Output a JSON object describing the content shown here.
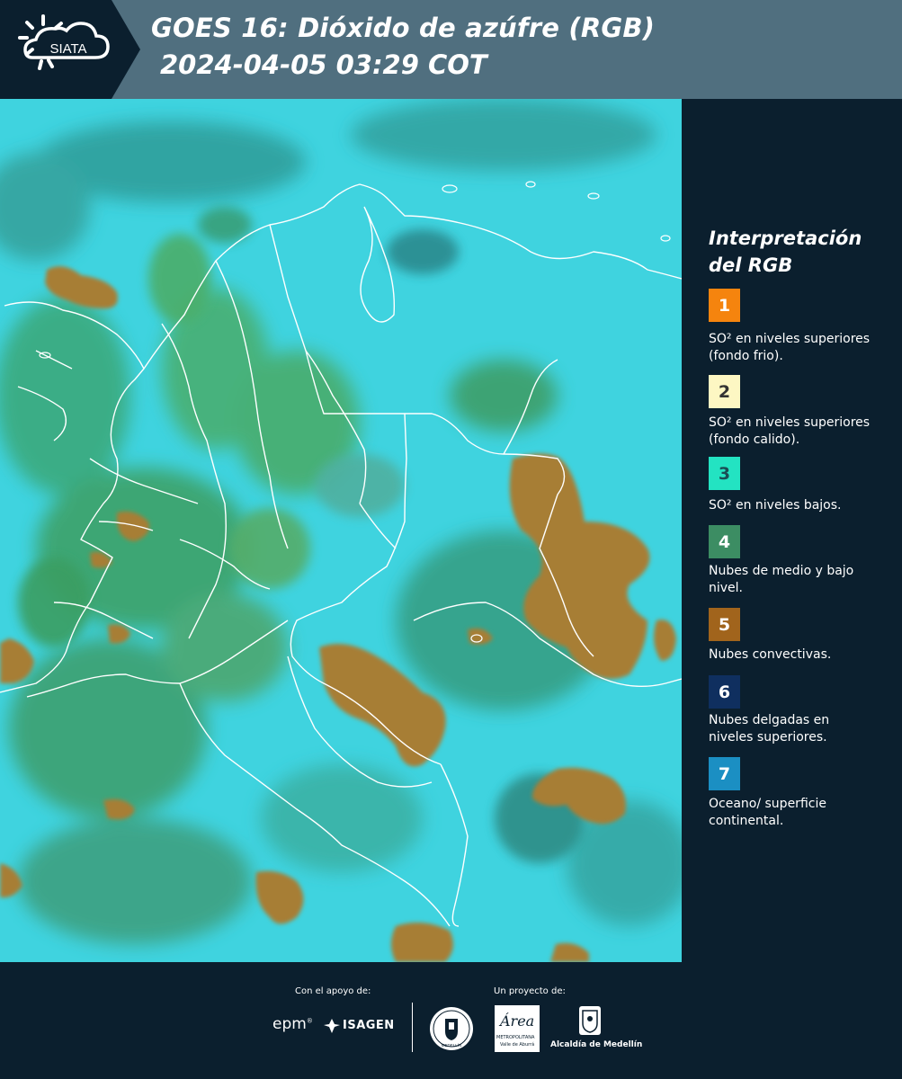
{
  "header": {
    "title_line1": "GOES 16: Dióxido de azúfre (RGB)",
    "title_line2": " 2024-04-05 03:29 COT",
    "logo_text": "SIATA",
    "colors": {
      "band": "#506f7f",
      "logo_tab": "#0b1f2e"
    }
  },
  "map": {
    "description_colors": {
      "ocean": "#3ed2df",
      "vegetation": "#4fae7a",
      "convective": "#a17a2f",
      "border": "#ffffff"
    }
  },
  "legend": {
    "title": "Interpretación del RGB",
    "items": [
      {
        "number": "1",
        "color": "#f5840e",
        "text_color": "#ffffff",
        "label": "SO² en niveles superiores (fondo frio)."
      },
      {
        "number": "2",
        "color": "#fdf7c3",
        "text_color": "#333333",
        "label": "SO² en niveles superiores (fondo calido)."
      },
      {
        "number": "3",
        "color": "#23e3c2",
        "text_color": "#1a4d55",
        "label": "SO² en niveles bajos."
      },
      {
        "number": "4",
        "color": "#3c8d63",
        "text_color": "#ffffff",
        "label": "Nubes de medio y bajo nivel."
      },
      {
        "number": "5",
        "color": "#a1641c",
        "text_color": "#ffffff",
        "label": "Nubes convectivas."
      },
      {
        "number": "6",
        "color": "#0f2f5f",
        "text_color": "#ffffff",
        "label": "Nubes delgadas en niveles superiores."
      },
      {
        "number": "7",
        "color": "#1b8fc3",
        "text_color": "#ffffff",
        "label": "Oceano/ superficie continental."
      }
    ]
  },
  "footer": {
    "support_caption": "Con el apoyo de:",
    "project_caption": "Un proyecto de:",
    "sponsor_epm": "epm",
    "sponsor_isagen": "ISAGEN",
    "sponsor_area": "Área",
    "sponsor_area_sub": "METROPOLITANA",
    "sponsor_area_sub2": "Valle de Aburrá",
    "sponsor_alcaldia": "Alcaldía de Medellín",
    "sponsor_medellin_seal": "MEDELLÍN"
  }
}
